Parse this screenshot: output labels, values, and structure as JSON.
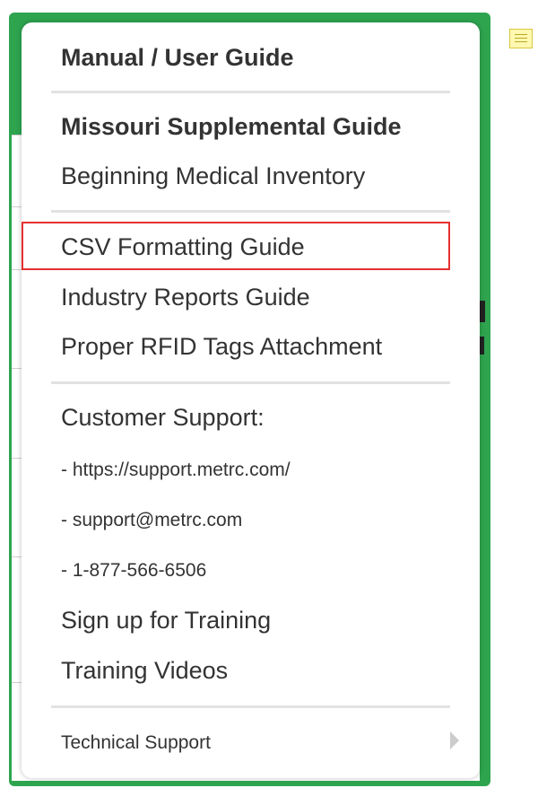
{
  "colors": {
    "frame_green": "#2ea44f",
    "highlight_red": "#e53030",
    "text": "#333333",
    "divider": "#e2e2e2"
  },
  "icons": {
    "note": "sticky-note-icon",
    "submenu": "chevron-right-icon"
  },
  "menu": {
    "items": [
      {
        "label": "Manual / User Guide"
      },
      {
        "label": "Missouri Supplemental Guide"
      },
      {
        "label": "Beginning Medical Inventory"
      },
      {
        "label": "CSV Formatting Guide"
      },
      {
        "label": "Industry Reports Guide"
      },
      {
        "label": "Proper RFID Tags Attachment"
      },
      {
        "label": "Customer Support:"
      },
      {
        "label": "- https://support.metrc.com/"
      },
      {
        "label": "- support@metrc.com"
      },
      {
        "label": "- 1-877-566-6506"
      },
      {
        "label": "Sign up for Training"
      },
      {
        "label": "Training Videos"
      },
      {
        "label": "Technical Support"
      }
    ]
  }
}
